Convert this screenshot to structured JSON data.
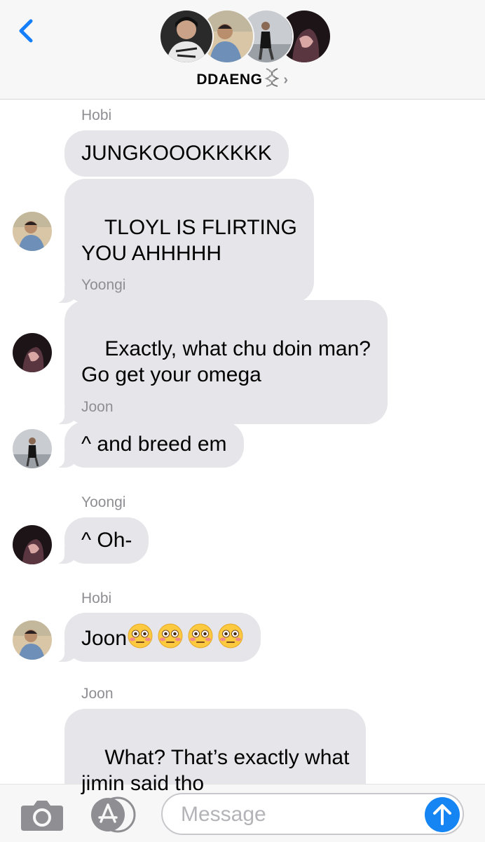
{
  "header": {
    "back_icon": "chevron-left-icon",
    "group_name": "DDAENG",
    "group_emoji": "dna-icon",
    "chevron": "›",
    "accent": "#157efb"
  },
  "messages": [
    {
      "sender": "Hobi",
      "bubbles": [
        "JUNGKOOOKKKKK",
        "TLOYL IS FLIRTING\nYOU AHHHHH"
      ],
      "avatar": "hobi"
    },
    {
      "sender": "Yoongi",
      "bubbles": [
        "Exactly, what chu doin man?\nGo get your omega"
      ],
      "avatar": "yoongi"
    },
    {
      "sender": "Joon",
      "bubbles": [
        "^ and breed em"
      ],
      "avatar": "joon"
    },
    {
      "sender": "Yoongi",
      "bubbles": [
        "^ Oh-"
      ],
      "avatar": "yoongi"
    },
    {
      "sender": "Hobi",
      "bubbles": [
        "Joon"
      ],
      "emoji_count": 4,
      "emoji": "flushed-face-icon",
      "avatar": "hobi"
    },
    {
      "sender": "Joon",
      "bubbles": [
        "What? That’s exactly what\njimin said tho"
      ]
    }
  ],
  "input_bar": {
    "camera_icon": "camera-icon",
    "apps_icon": "app-store-icon",
    "placeholder": "Message",
    "send_icon": "arrow-up-icon",
    "send_color": "#1585f4"
  }
}
